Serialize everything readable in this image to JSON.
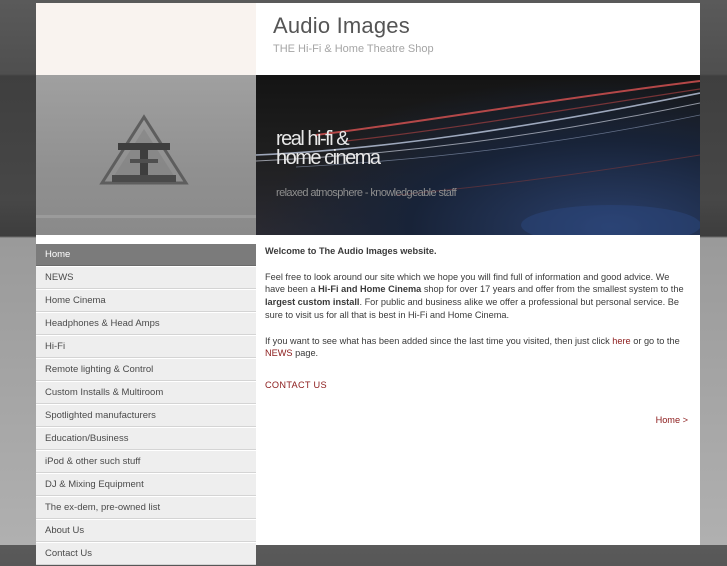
{
  "header": {
    "title": "Audio Images",
    "subtitle": "THE Hi-Fi & Home Theatre Shop"
  },
  "banner": {
    "headline_line1": "real hi-fi &",
    "headline_line2": "home cinema",
    "tagline": "relaxed atmosphere - knowledgeable staff",
    "logo_icon": "triangle-AI-logo-icon"
  },
  "sidebar": {
    "items": [
      {
        "label": "Home",
        "active": true
      },
      {
        "label": "NEWS"
      },
      {
        "label": "Home Cinema"
      },
      {
        "label": "Headphones & Head Amps"
      },
      {
        "label": "Hi-Fi"
      },
      {
        "label": "Remote lighting & Control"
      },
      {
        "label": "Custom Installs & Multiroom"
      },
      {
        "label": "Spotlighted manufacturers"
      },
      {
        "label": "Education/Business"
      },
      {
        "label": "iPod & other such stuff"
      },
      {
        "label": "DJ & Mixing Equipment"
      },
      {
        "label": "The ex-dem, pre-owned list"
      },
      {
        "label": "About Us"
      },
      {
        "label": "Contact Us"
      }
    ]
  },
  "main": {
    "welcome": "Welcome to The Audio Images website.",
    "p1_a": "Feel free to look around our site which we hope you will find full of information and good advice. We have been a ",
    "p1_b": "Hi-Fi and Home Cinema",
    "p1_c": " shop for over 17 years and offer from the smallest system to the ",
    "p1_d": "largest custom install",
    "p1_e": ". For public and business alike we offer a professional but personal service. Be sure to visit us for all that is best in Hi-Fi and Home Cinema.",
    "p2_a": "If you want to see what has been added since the last time you visited, then just click ",
    "p2_link1": "here",
    "p2_b": " or go to the ",
    "p2_link2": "NEWS",
    "p2_c": " page.",
    "contact": "CONTACT US",
    "breadcrumb": "Home >"
  },
  "colors": {
    "link": "#8b1a1a",
    "nav_active": "#7b7b7b",
    "nav_bg": "#eeeeee"
  }
}
